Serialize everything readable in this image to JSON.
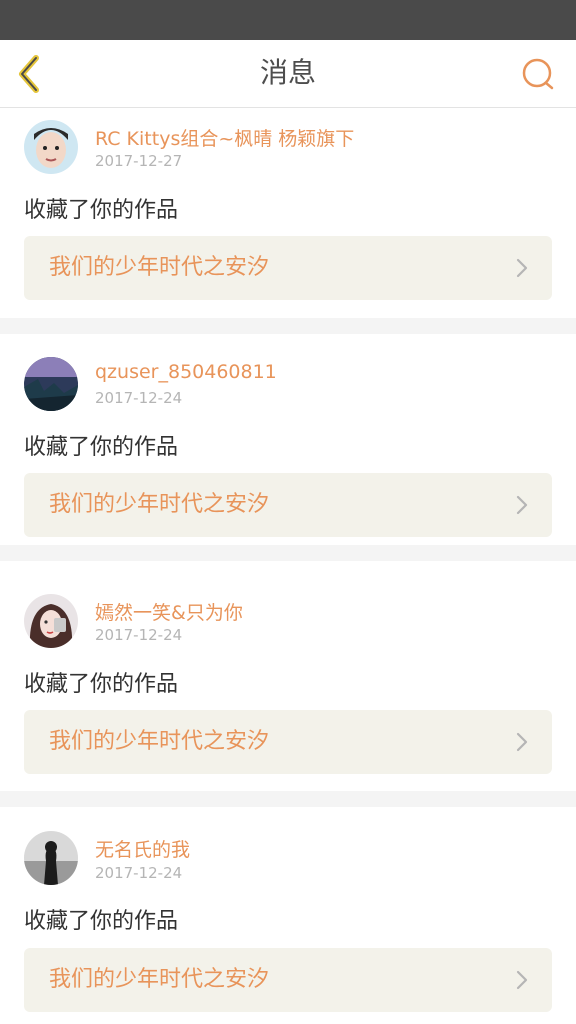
{
  "header": {
    "title": "消息",
    "back_icon": "chevron-left-icon",
    "search_icon": "search-icon",
    "accent_color": "#e8945a"
  },
  "messages": [
    {
      "username": "RC Kittys组合~枫晴 杨颖旗下",
      "date": "2017-12-27",
      "action": "收藏了你的作品",
      "work_title": "我们的少年时代之安汐"
    },
    {
      "username": "qzuser_850460811",
      "date": "2017-12-24",
      "action": "收藏了你的作品",
      "work_title": "我们的少年时代之安汐"
    },
    {
      "username": "嫣然一笑&只为你",
      "date": "2017-12-24",
      "action": "收藏了你的作品",
      "work_title": "我们的少年时代之安汐"
    },
    {
      "username": "无名氏的我",
      "date": "2017-12-24",
      "action": "收藏了你的作品",
      "work_title": "我们的少年时代之安汐"
    }
  ]
}
